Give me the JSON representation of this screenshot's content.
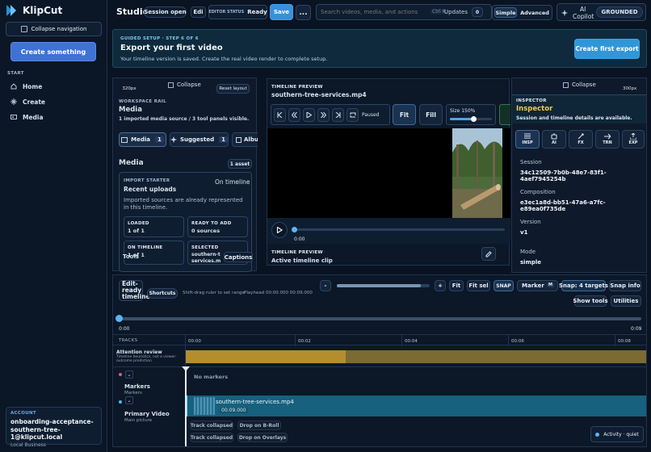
{
  "app": {
    "logo_text": "KlipCut"
  },
  "sidebar": {
    "collapse_label": "Collapse navigation",
    "create_button": "Create something",
    "section_label": "START",
    "items": [
      {
        "label": "Home",
        "icon": "home-icon"
      },
      {
        "label": "Create",
        "icon": "create-icon"
      },
      {
        "label": "Media",
        "icon": "media-icon"
      }
    ],
    "account": {
      "caption": "ACCOUNT",
      "name_line1": "onboarding-acceptance-",
      "name_line2": "southern-tree-1@klipcut.local",
      "business": "Local Business"
    }
  },
  "header": {
    "title": "Studio",
    "session_badge": "Session open",
    "edit_chip": "Edi",
    "editor_status_label": "EDITOR STATUS",
    "editor_status_value": "Ready",
    "save_label": "Save",
    "more_label": "...",
    "search_placeholder": "Search videos, media, and actions",
    "search_shortcut": "Ctrl K",
    "updates_label": "Updates",
    "updates_count": "0",
    "mode_simple": "Simple",
    "mode_advanced": "Advanced",
    "ai_copilot_line1": "AI",
    "ai_copilot_line2": "Copilot",
    "grounded_label": "GROUNDED"
  },
  "setup": {
    "step_label": "GUIDED SETUP · STEP 6 OF 6",
    "title": "Export your first video",
    "description": "Your timeline version is saved. Create the real video render to complete setup.",
    "cta": "Create first export"
  },
  "left_panel": {
    "width_label": "320px",
    "collapse": "Collapse",
    "reset": "Reset layout",
    "rail_caption": "WORKSPACE RAIL",
    "rail_title": "Media",
    "rail_desc": "1 imported media source / 3 tool panels visible.",
    "tabs": [
      {
        "label": "Media",
        "count": "1"
      },
      {
        "label": "Suggested",
        "count": "1"
      },
      {
        "label": "Albu",
        "count": ""
      }
    ],
    "media_heading": "Media",
    "asset_badge": "1 asset",
    "starter_caption": "IMPORT STARTER",
    "starter_title": "Recent uploads",
    "starter_status": "On timeline",
    "starter_desc": "Imported sources are already represented in this timeline.",
    "stats": [
      {
        "label": "LOADED",
        "value": "1 of 1"
      },
      {
        "label": "READY TO ADD",
        "value": "0 sources"
      },
      {
        "label": "ON TIMELINE",
        "value": "1 of 1"
      },
      {
        "label": "SELECTED",
        "value": "southern-t services.m"
      }
    ],
    "tools_label": "Tools",
    "captions_label": "Captions"
  },
  "preview": {
    "caption": "TIMELINE PREVIEW",
    "filename": "southern-tree-services.mp4",
    "paused_label": "Paused",
    "fit_label": "Fit",
    "fill_label": "Fill",
    "size_label": "Size 150%",
    "size_fraction": 0.55,
    "time_label": "0:00",
    "footer_caption": "TIMELINE PREVIEW",
    "footer_title": "Active timeline clip"
  },
  "inspector": {
    "collapse": "Collapse",
    "width_label": "300px",
    "caption": "INSPECTOR",
    "title": "Inspector",
    "desc": "Session and timeline details are available.",
    "tabs": [
      {
        "label": "INSP",
        "icon": "inspector-icon"
      },
      {
        "label": "AI",
        "icon": "ai-icon"
      },
      {
        "label": "FX",
        "icon": "fx-icon"
      },
      {
        "label": "TRN",
        "icon": "transition-icon"
      },
      {
        "label": "EXP",
        "icon": "export-icon"
      }
    ],
    "fields": [
      {
        "label": "Session",
        "value": "34c12509-7b0b-48e7-83f1-4aef7945254b"
      },
      {
        "label": "Composition",
        "value": "e3ec1a8d-bb51-47a6-a7fc-e89ea0f735de"
      },
      {
        "label": "Version",
        "value": "v1"
      },
      {
        "label": "Mode",
        "value": "simple"
      }
    ]
  },
  "timeline": {
    "status_line1": "Edit-",
    "status_line2": "ready",
    "status_line3": "timeline",
    "shortcuts": "Shortcuts",
    "hint": "Shift-drag ruler to set range",
    "playhead": "Playhead 00:00.000 00:09.000",
    "minus": "-",
    "plus": "+",
    "zoom_fraction": 0.9,
    "fit": "Fit",
    "fit_sel": "Fit sel",
    "snap": "SNAP",
    "marker": "Marker",
    "marker_key": "M",
    "snap_targets": "Snap: 4 targets",
    "snap_info": "Snap info",
    "show_tools": "Show tools",
    "utilities": "Utilities",
    "scrub_start": "0:00",
    "scrub_end": "0:09",
    "tracks_label": "TRACKS",
    "ruler": [
      "00:00",
      "00:02",
      "00:04",
      "00:06",
      "00:08"
    ],
    "attention_title": "Attention review",
    "attention_desc": "Timeline heuristics, not a viewer-outcome prediction",
    "no_markers": "No markers",
    "markers_track": "Markers",
    "markers_sub": "Markers",
    "clip_name": "southern-tree-services.mp4",
    "clip_time": "00:09.000",
    "primary_track": "Primary Video",
    "primary_sub": "Main picture",
    "track_collapsed": "Track collapsed",
    "drop_broll": "Drop on B-Roll",
    "drop_overlays": "Drop on Overlays",
    "activity": "Activity · quiet"
  },
  "colors": {
    "accent": "#2d8fd6",
    "gold": "#c9a23a",
    "clip": "#2a6f8f",
    "bg": "#0a1321"
  }
}
